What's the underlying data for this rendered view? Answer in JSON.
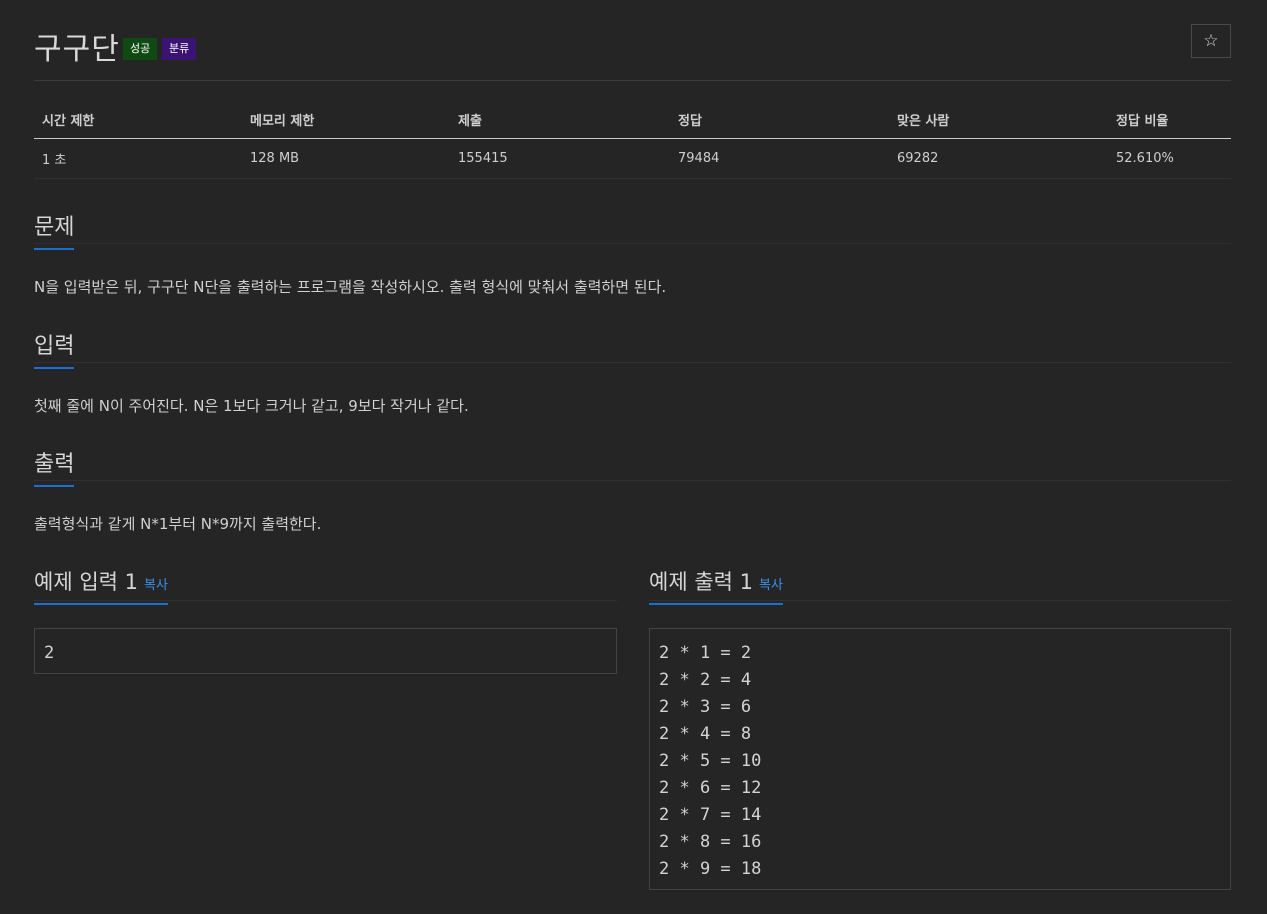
{
  "problem": {
    "title": "구구단",
    "badges": {
      "success": "성공",
      "category": "분류"
    },
    "star_icon": "star-icon"
  },
  "info": {
    "headers": [
      "시간 제한",
      "메모리 제한",
      "제출",
      "정답",
      "맞은 사람",
      "정답 비율"
    ],
    "values": [
      "1 초",
      "128 MB",
      "155415",
      "79484",
      "69282",
      "52.610%"
    ]
  },
  "sections": {
    "description": {
      "heading": "문제",
      "text": "N을 입력받은 뒤, 구구단 N단을 출력하는 프로그램을 작성하시오. 출력 형식에 맞춰서 출력하면 된다."
    },
    "input": {
      "heading": "입력",
      "text": "첫째 줄에 N이 주어진다. N은 1보다 크거나 같고, 9보다 작거나 같다."
    },
    "output": {
      "heading": "출력",
      "text": "출력형식과 같게 N*1부터 N*9까지 출력한다."
    }
  },
  "samples": {
    "input": {
      "heading": "예제 입력 1",
      "copy_label": "복사",
      "content": "2"
    },
    "output": {
      "heading": "예제 출력 1",
      "copy_label": "복사",
      "content": "2 * 1 = 2\n2 * 2 = 4\n2 * 3 = 6\n2 * 4 = 8\n2 * 5 = 10\n2 * 6 = 12\n2 * 7 = 14\n2 * 8 = 16\n2 * 9 = 18"
    }
  },
  "colors": {
    "background": "#252526",
    "accent": "#1a6fd0",
    "success_badge": "#0f4a13",
    "category_badge": "#3a1373",
    "copy_link": "#3d8fe8"
  }
}
